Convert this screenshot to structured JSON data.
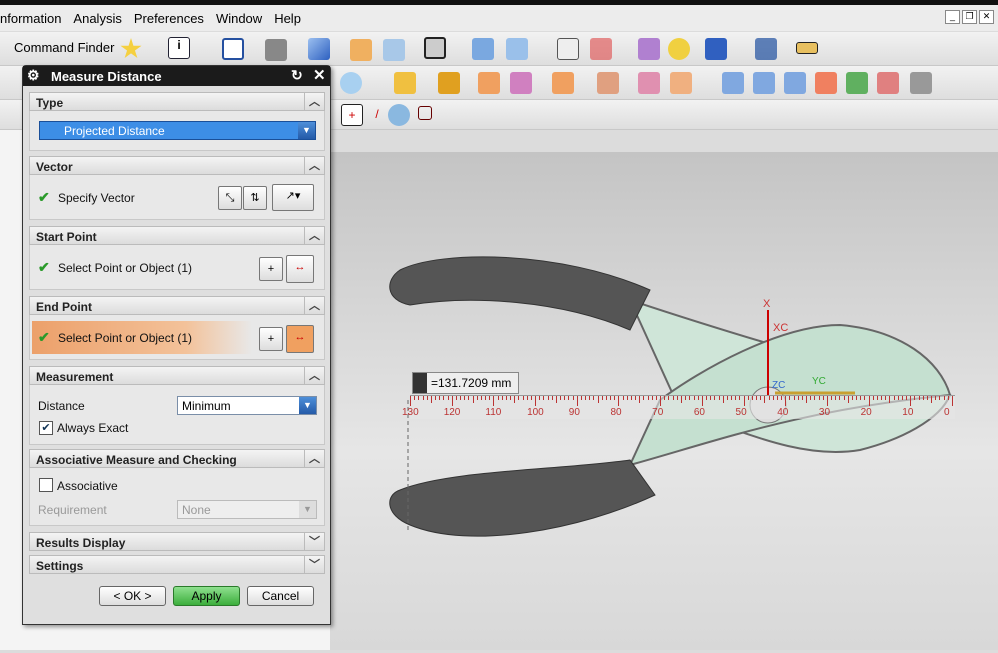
{
  "menu": [
    "nformation",
    "Analysis",
    "Preferences",
    "Window",
    "Help"
  ],
  "toolbar": {
    "command_finder": "Command Finder"
  },
  "dialog": {
    "title": "Measure Distance",
    "type": {
      "header": "Type",
      "value": "Projected Distance"
    },
    "vector": {
      "header": "Vector",
      "label": "Specify Vector"
    },
    "start_point": {
      "header": "Start Point",
      "label": "Select Point or Object (1)"
    },
    "end_point": {
      "header": "End Point",
      "label": "Select Point or Object (1)"
    },
    "measurement": {
      "header": "Measurement",
      "distance_label": "Distance",
      "distance_value": "Minimum",
      "always_exact_label": "Always Exact",
      "always_exact_checked": true
    },
    "associative": {
      "header": "Associative Measure and Checking",
      "associative_label": "Associative",
      "associative_checked": false,
      "requirement_label": "Requirement",
      "requirement_value": "None"
    },
    "results_display": "Results Display",
    "settings": "Settings",
    "buttons": {
      "ok": "< OK >",
      "apply": "Apply",
      "cancel": "Cancel"
    }
  },
  "viewport": {
    "measure_label": "=131.7209 mm",
    "ruler_ticks": [
      "130",
      "120",
      "110",
      "100",
      "90",
      "80",
      "70",
      "60",
      "50",
      "40",
      "30",
      "20",
      "10",
      "0"
    ],
    "axes": {
      "x": "X",
      "xc": "XC",
      "yc": "YC",
      "zc": "ZC"
    }
  },
  "colors": {
    "highlight": "#f0b080",
    "selection": "#3d8ee6",
    "apply": "#4fc24f"
  }
}
